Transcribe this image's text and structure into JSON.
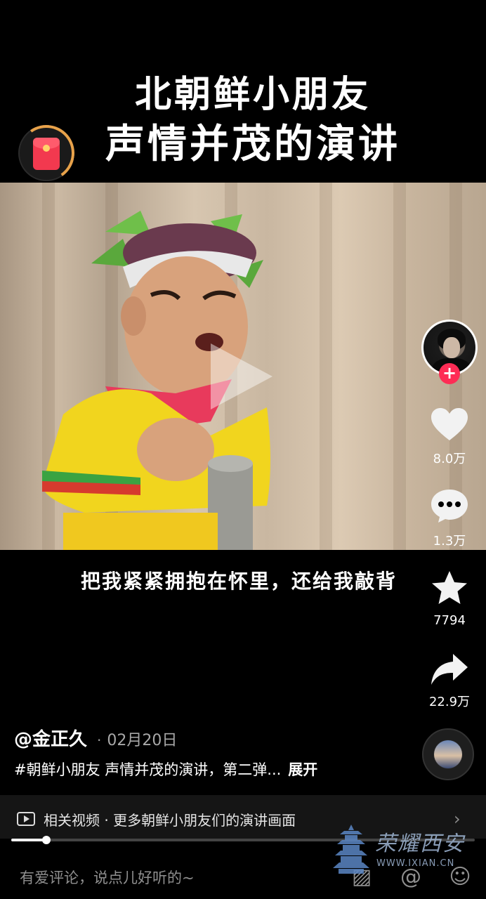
{
  "video": {
    "title_line1": "北朝鲜小朋友",
    "title_line2": "声情并茂的演讲",
    "subtitle": "把我紧紧拥抱在怀里，还给我敲背"
  },
  "actions": {
    "likes": "8.0万",
    "comments": "1.3万",
    "favorites": "7794",
    "shares": "22.9万",
    "follow_symbol": "+"
  },
  "author": {
    "name": "@金正久",
    "dot": "·",
    "date": "02月20日"
  },
  "description": {
    "text": "#朝鲜小朋友 声情并茂的演讲，第二弹...",
    "expand": "展开"
  },
  "related": {
    "text": "相关视频 · 更多朝鲜小朋友们的演讲画面",
    "chevron": "›"
  },
  "progress": {
    "fraction": 0.075
  },
  "comment_bar": {
    "placeholder": "有爱评论，说点儿好听的~",
    "image_icon": "▨",
    "at_icon": "@",
    "emoji_icon": "☺"
  },
  "watermark": {
    "text": "荣耀西安",
    "url": "WWW.IXIAN.CN"
  },
  "colors": {
    "accent": "#fe2c55",
    "redpacket": "#f2394f",
    "ring": "#e8a24a"
  },
  "icons": {
    "redpacket": "red-packet-icon",
    "like": "heart-icon",
    "comment": "speech-bubble-icon",
    "favorite": "star-icon",
    "share": "share-arrow-icon",
    "play": "play-icon",
    "related": "video-icon"
  }
}
